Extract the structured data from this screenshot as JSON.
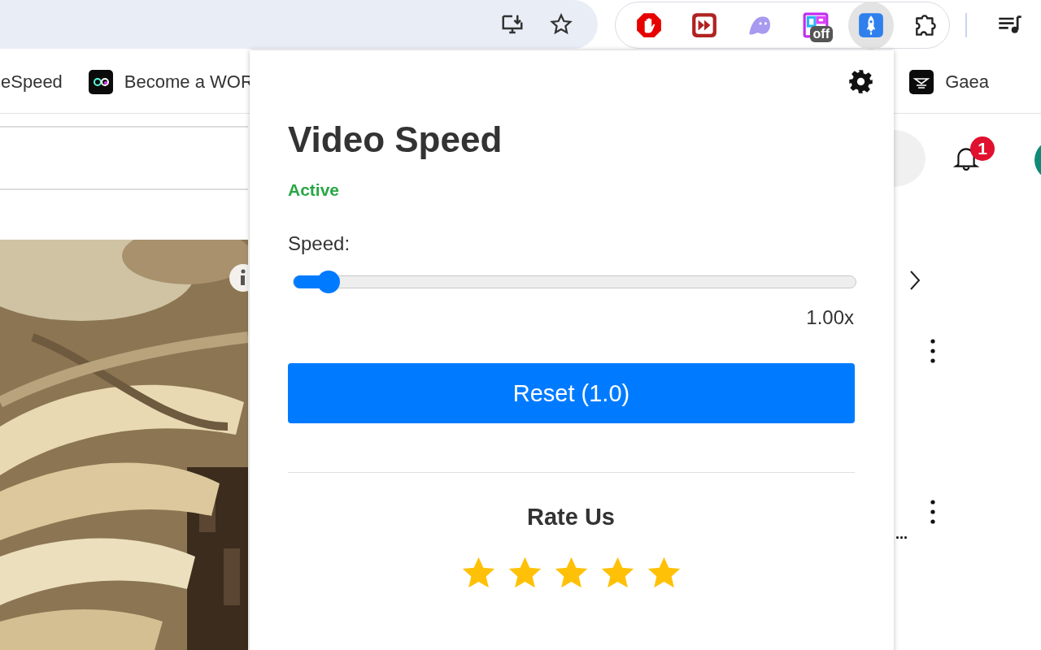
{
  "toolbar": {
    "extensions": [
      {
        "kind": "blocker",
        "selected": false
      },
      {
        "kind": "fast-forward",
        "selected": false
      },
      {
        "kind": "ghost",
        "selected": false
      },
      {
        "kind": "grid",
        "selected": false,
        "badge": "off"
      },
      {
        "kind": "rocket",
        "selected": true
      },
      {
        "kind": "puzzle",
        "selected": false
      }
    ]
  },
  "bookmarks": [
    {
      "label": "eSpeed",
      "kind": "none"
    },
    {
      "label": "Become a WOR",
      "kind": "eyes"
    },
    {
      "label": "Gaea",
      "kind": "speaker"
    }
  ],
  "page": {
    "notification_count": "1",
    "truncated_text": "..."
  },
  "popup": {
    "title": "Video Speed",
    "status": "Active",
    "speed_label": "Speed:",
    "slider": {
      "level": 0.064
    },
    "reading": "1.00x",
    "reset_button": "Reset (1.0)",
    "rate_heading": "Rate Us",
    "stars": 5
  }
}
